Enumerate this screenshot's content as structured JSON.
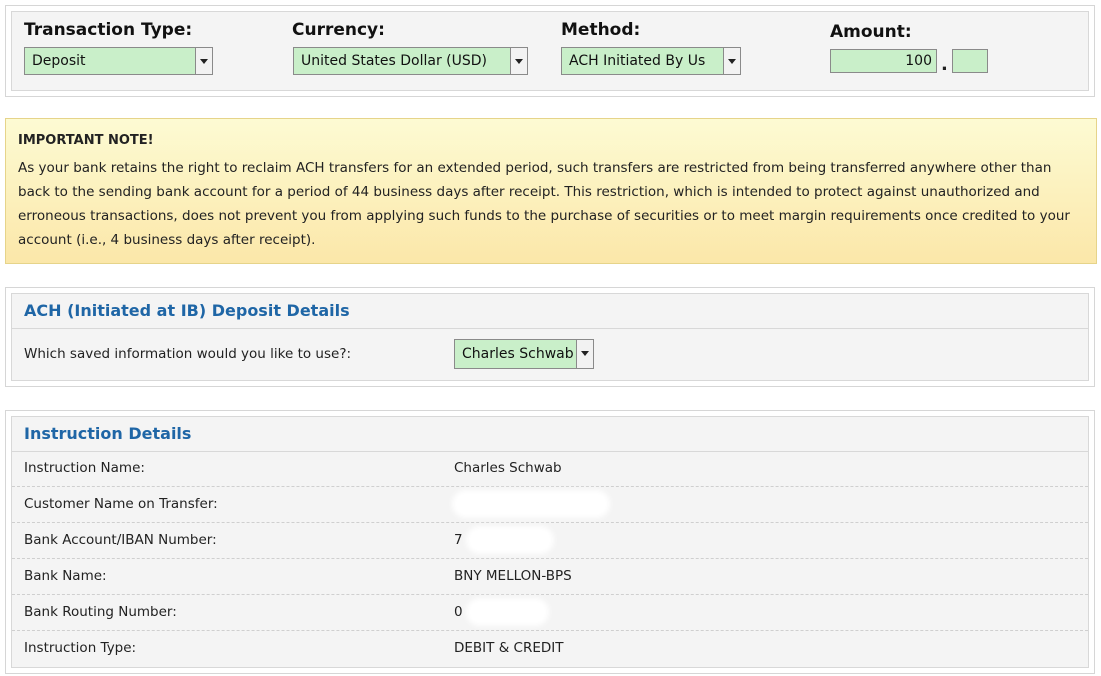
{
  "form": {
    "transaction_type": {
      "label": "Transaction Type:",
      "value": "Deposit"
    },
    "currency": {
      "label": "Currency:",
      "value": "United States Dollar (USD)"
    },
    "method": {
      "label": "Method:",
      "value": "ACH Initiated By Us"
    },
    "amount": {
      "label": "Amount:",
      "whole": "100",
      "separator": ".",
      "cents": ""
    }
  },
  "note": {
    "title": "IMPORTANT NOTE!",
    "body": "As your bank retains the right to reclaim ACH transfers for an extended period, such transfers are restricted from being transferred anywhere other than back to the sending bank account for a period of 44 business days after receipt. This restriction, which is intended to protect against unauthorized and erroneous transactions, does not prevent you from applying such funds to the purchase of securities or to meet margin requirements once credited to your account (i.e., 4 business days after receipt)."
  },
  "deposit_details": {
    "title": "ACH (Initiated at IB) Deposit Details",
    "question": "Which saved information would you like to use?:",
    "selected": "Charles Schwab"
  },
  "instruction_details": {
    "title": "Instruction Details",
    "rows": [
      {
        "key": "Instruction Name:",
        "value": "Charles Schwab"
      },
      {
        "key": "Customer Name on Transfer:",
        "value": ""
      },
      {
        "key": "Bank Account/IBAN Number:",
        "value": "7"
      },
      {
        "key": "Bank Name:",
        "value": "BNY MELLON-BPS"
      },
      {
        "key": "Bank Routing Number:",
        "value": "0"
      },
      {
        "key": "Instruction Type:",
        "value": "DEBIT & CREDIT"
      }
    ]
  },
  "colors": {
    "field_bg": "#c9efc9",
    "heading": "#1f66a6",
    "note_bg": "#fbe7a9"
  }
}
